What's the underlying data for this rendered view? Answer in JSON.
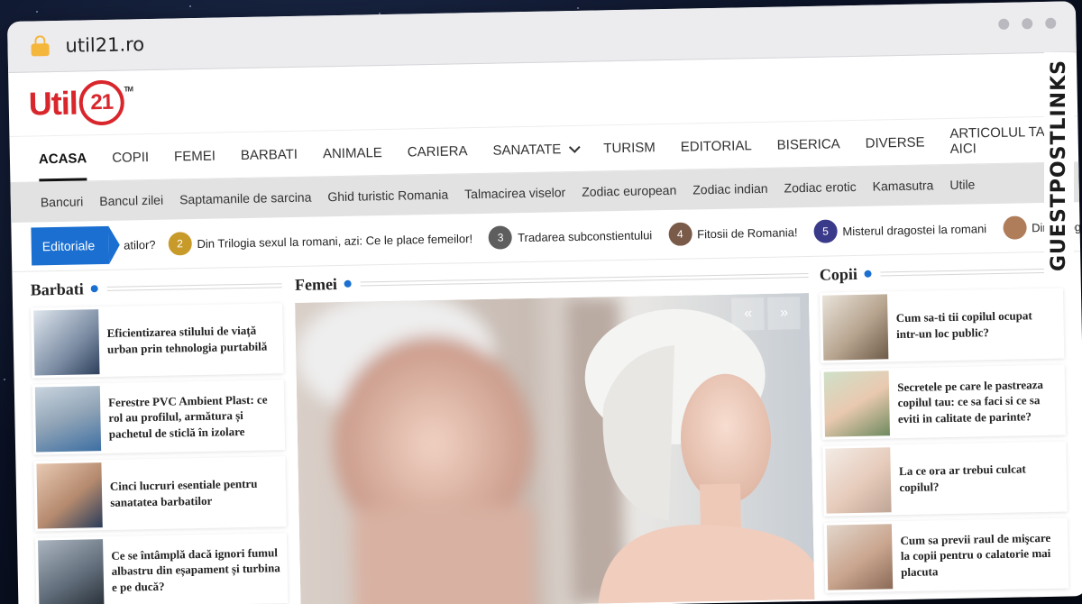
{
  "browser": {
    "url": "util21.ro"
  },
  "site": {
    "logo_text": "Util",
    "logo_number": "21",
    "logo_tm": "TM"
  },
  "main_nav": [
    {
      "label": "ACASA",
      "active": true
    },
    {
      "label": "COPII"
    },
    {
      "label": "FEMEI"
    },
    {
      "label": "BARBATI"
    },
    {
      "label": "ANIMALE"
    },
    {
      "label": "CARIERA"
    },
    {
      "label": "SANATATE",
      "dropdown": true
    },
    {
      "label": "TURISM"
    },
    {
      "label": "EDITORIAL"
    },
    {
      "label": "BISERICA"
    },
    {
      "label": "DIVERSE"
    },
    {
      "label": "ARTICOLUL TAU AICI"
    }
  ],
  "sub_nav": [
    "Bancuri",
    "Bancul zilei",
    "Saptamanile de sarcina",
    "Ghid turistic Romania",
    "Talmacirea viselor",
    "Zodiac european",
    "Zodiac indian",
    "Zodiac erotic",
    "Kamasutra",
    "Utile"
  ],
  "ticker": {
    "label": "Editoriale",
    "lead_fragment": "atilor?",
    "items": [
      {
        "num": "2",
        "text": "Din Trilogia sexul la romani, azi: Ce le place femeilor!"
      },
      {
        "num": "3",
        "text": "Tradarea subconstientului"
      },
      {
        "num": "4",
        "text": "Fitosii de Romania!"
      },
      {
        "num": "5",
        "text": "Misterul dragostei la romani"
      },
      {
        "num": "",
        "text": "Din Trilogia"
      }
    ]
  },
  "sections": {
    "barbati": {
      "title": "Barbati",
      "posts": [
        {
          "title": "Eficientizarea stilului de viață urban prin tehnologia purtabilă"
        },
        {
          "title": "Ferestre PVC Ambient Plast: ce rol au profilul, armătura și pachetul de sticlă în izolare"
        },
        {
          "title": "Cinci lucruri esentiale pentru sanatatea barbatilor"
        },
        {
          "title": "Ce se întâmplă dacă ignori fumul albastru din eșapament și turbina e pe ducă?"
        }
      ]
    },
    "femei": {
      "title": "Femei",
      "prev": "«",
      "next": "»"
    },
    "copii": {
      "title": "Copii",
      "posts": [
        {
          "title": "Cum sa-ti tii copilul ocupat intr-un loc public?"
        },
        {
          "title": "Secretele pe care le pastreaza copilul tau: ce sa faci si ce sa eviti in calitate de parinte?"
        },
        {
          "title": "La ce ora ar trebui culcat copilul?"
        },
        {
          "title": "Cum sa previi raul de mişcare la copii pentru o calatorie mai placuta"
        }
      ]
    }
  },
  "side_brand": "GUESTPOSTLINKS",
  "colors": {
    "accent": "#1a6fd1",
    "logo_red": "#d8262c",
    "brand_orange": "#f26a2e"
  }
}
